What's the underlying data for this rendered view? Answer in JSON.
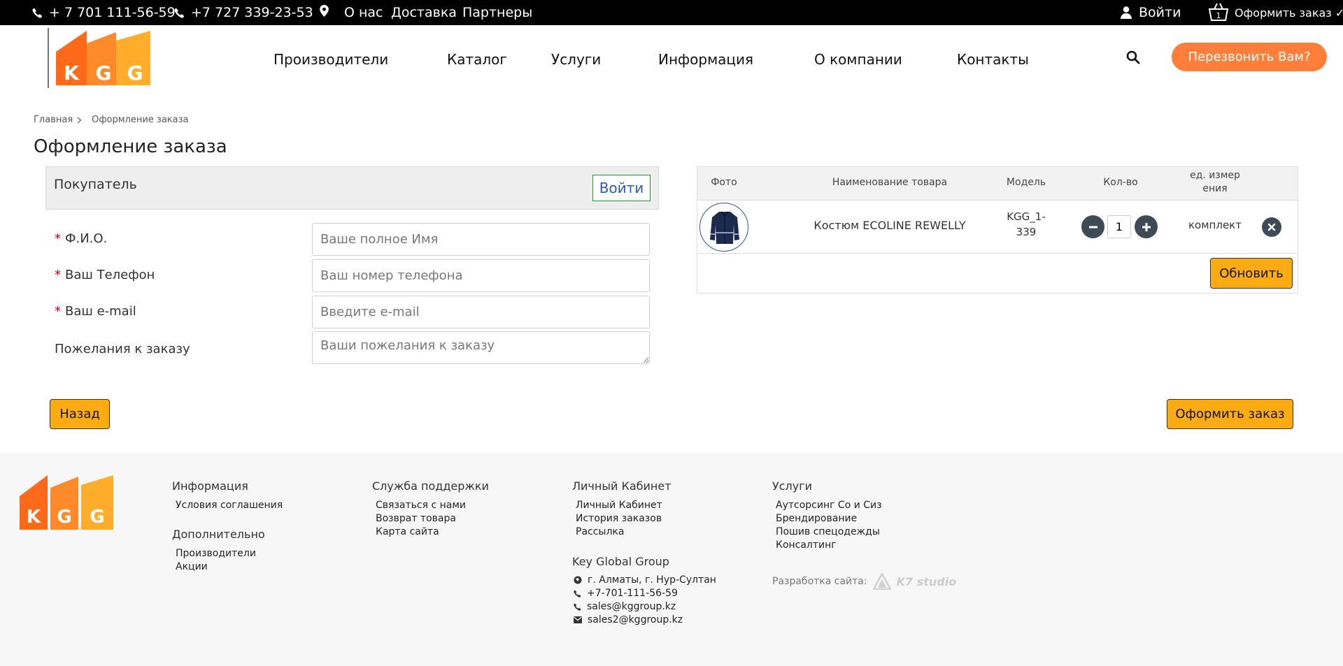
{
  "topbar": {
    "phone1": "+ 7 701 111-56-59",
    "phone2": "+7 727 339-23-53",
    "links": [
      "О нас",
      "Доставка",
      "Партнеры"
    ],
    "login": "Войти",
    "cart_count": "1",
    "checkout": "Оформить заказ"
  },
  "nav": {
    "items": [
      "Производители",
      "Каталог",
      "Услуги",
      "Информация",
      "О компании",
      "Контакты"
    ],
    "callback": "Перезвонить Вам?"
  },
  "breadcrumb": {
    "home": "Главная",
    "current": "Оформление заказа"
  },
  "page_title": "Оформление заказа",
  "buyer": {
    "title": "Покупатель",
    "login": "Войти",
    "fields": [
      {
        "label": "Ф.И.О.",
        "placeholder": "Ваше полное Имя",
        "required": true
      },
      {
        "label": "Ваш Телефон",
        "placeholder": "Ваш номер телефона",
        "required": true
      },
      {
        "label": "Ваш e-mail",
        "placeholder": "Введите e-mail",
        "required": true
      },
      {
        "label": "Пожелания к заказу",
        "placeholder": "Ваши пожелания к заказу",
        "required": false
      }
    ],
    "back": "Назад",
    "submit": "Оформить заказ"
  },
  "cart": {
    "headers": {
      "photo": "Фото",
      "name": "Наименование товара",
      "model": "Модель",
      "qty": "Кол-во",
      "unit_1": "ед. измер",
      "unit_2": "ения"
    },
    "items": [
      {
        "name": "Костюм ECOLINE REWELLY",
        "model_1": "KGG_1-",
        "model_2": "339",
        "qty": "1",
        "unit": "комплект"
      }
    ],
    "update": "Обновить"
  },
  "footer": {
    "info": {
      "title": "Информация",
      "links": [
        "Условия соглашения"
      ]
    },
    "extra": {
      "title": "Дополнительно",
      "links": [
        "Производители",
        "Акции"
      ]
    },
    "support": {
      "title": "Служба поддержки",
      "links": [
        "Связаться с нами",
        "Возврат товара",
        "Карта сайта"
      ]
    },
    "account": {
      "title": "Личный Кабинет",
      "links": [
        "Личный Кабинет",
        "История заказов",
        "Рассылка"
      ]
    },
    "company": {
      "title": "Key Global Group",
      "address": "г. Алматы, г. Нур-Султан",
      "phone": "+7-701-111-56-59",
      "email1": "sales@kggroup.kz",
      "email2": "sales2@kggroup.kz"
    },
    "services": {
      "title": "Услуги",
      "links": [
        "Аутсорсинг Со и Сиз",
        "Брендирование",
        "Пошив спецодежды",
        "Консалтинг"
      ]
    },
    "dev_label": "Разработка сайта:",
    "dev_name": "K7 studio"
  },
  "colors": {
    "accent_orange": "#ff7f3a",
    "button_yellow": "#fcac12",
    "topbar": "#000000"
  }
}
